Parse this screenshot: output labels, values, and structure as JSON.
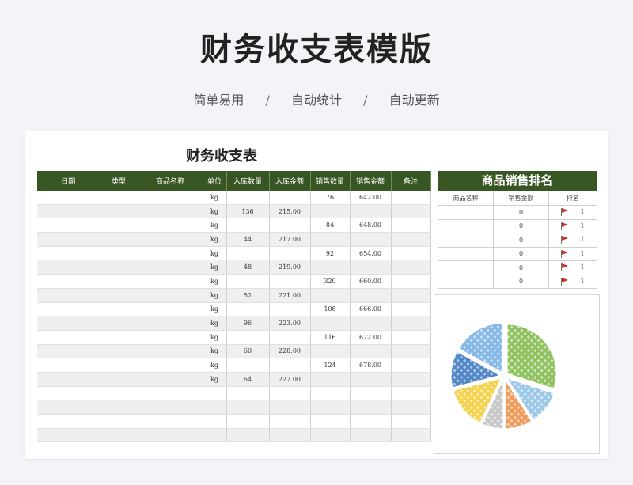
{
  "page": {
    "title": "财务收支表模版",
    "tags": [
      "简单易用",
      "自动统计",
      "自动更新"
    ],
    "separator": "/"
  },
  "sheet": {
    "title": "财务收支表",
    "columns": [
      "日期",
      "类型",
      "商品名称",
      "单位",
      "入库数量",
      "入库金额",
      "销售数量",
      "销售金额",
      "备注"
    ],
    "rows": [
      [
        "",
        "",
        "",
        "kg",
        "",
        "",
        "76",
        "642.00",
        ""
      ],
      [
        "",
        "",
        "",
        "kg",
        "136",
        "215.00",
        "",
        "",
        ""
      ],
      [
        "",
        "",
        "",
        "kg",
        "",
        "",
        "84",
        "648.00",
        ""
      ],
      [
        "",
        "",
        "",
        "kg",
        "44",
        "217.00",
        "",
        "",
        ""
      ],
      [
        "",
        "",
        "",
        "kg",
        "",
        "",
        "92",
        "654.00",
        ""
      ],
      [
        "",
        "",
        "",
        "kg",
        "48",
        "219.00",
        "",
        "",
        ""
      ],
      [
        "",
        "",
        "",
        "kg",
        "",
        "",
        "320",
        "660.00",
        ""
      ],
      [
        "",
        "",
        "",
        "kg",
        "52",
        "221.00",
        "",
        "",
        ""
      ],
      [
        "",
        "",
        "",
        "kg",
        "",
        "",
        "108",
        "666.00",
        ""
      ],
      [
        "",
        "",
        "",
        "kg",
        "96",
        "223.00",
        "",
        "",
        ""
      ],
      [
        "",
        "",
        "",
        "kg",
        "",
        "",
        "116",
        "672.00",
        ""
      ],
      [
        "",
        "",
        "",
        "kg",
        "60",
        "228.00",
        "",
        "",
        ""
      ],
      [
        "",
        "",
        "",
        "kg",
        "",
        "",
        "124",
        "678.00",
        ""
      ],
      [
        "",
        "",
        "",
        "kg",
        "64",
        "227.00",
        "",
        "",
        ""
      ],
      [
        "",
        "",
        "",
        "",
        "",
        "",
        "",
        "",
        ""
      ],
      [
        "",
        "",
        "",
        "",
        "",
        "",
        "",
        "",
        ""
      ],
      [
        "",
        "",
        "",
        "",
        "",
        "",
        "",
        "",
        ""
      ],
      [
        "",
        "",
        "",
        "",
        "",
        "",
        "",
        "",
        ""
      ]
    ]
  },
  "ranking": {
    "title": "商品销售排名",
    "columns": [
      "商品名称",
      "销售金额",
      "排名"
    ],
    "rows": [
      [
        "",
        "0",
        "1"
      ],
      [
        "",
        "0",
        "1"
      ],
      [
        "",
        "0",
        "1"
      ],
      [
        "",
        "0",
        "1"
      ],
      [
        "",
        "0",
        "1"
      ],
      [
        "",
        "0",
        "1"
      ]
    ]
  },
  "chart_data": {
    "type": "pie",
    "title": "",
    "values": [
      30,
      11,
      9,
      7,
      14,
      12,
      17
    ],
    "colors": [
      "#8fc25e",
      "#9bc8e6",
      "#ee9b5a",
      "#c8c8c8",
      "#f3d24d",
      "#4f86c6",
      "#86b8e6"
    ]
  }
}
